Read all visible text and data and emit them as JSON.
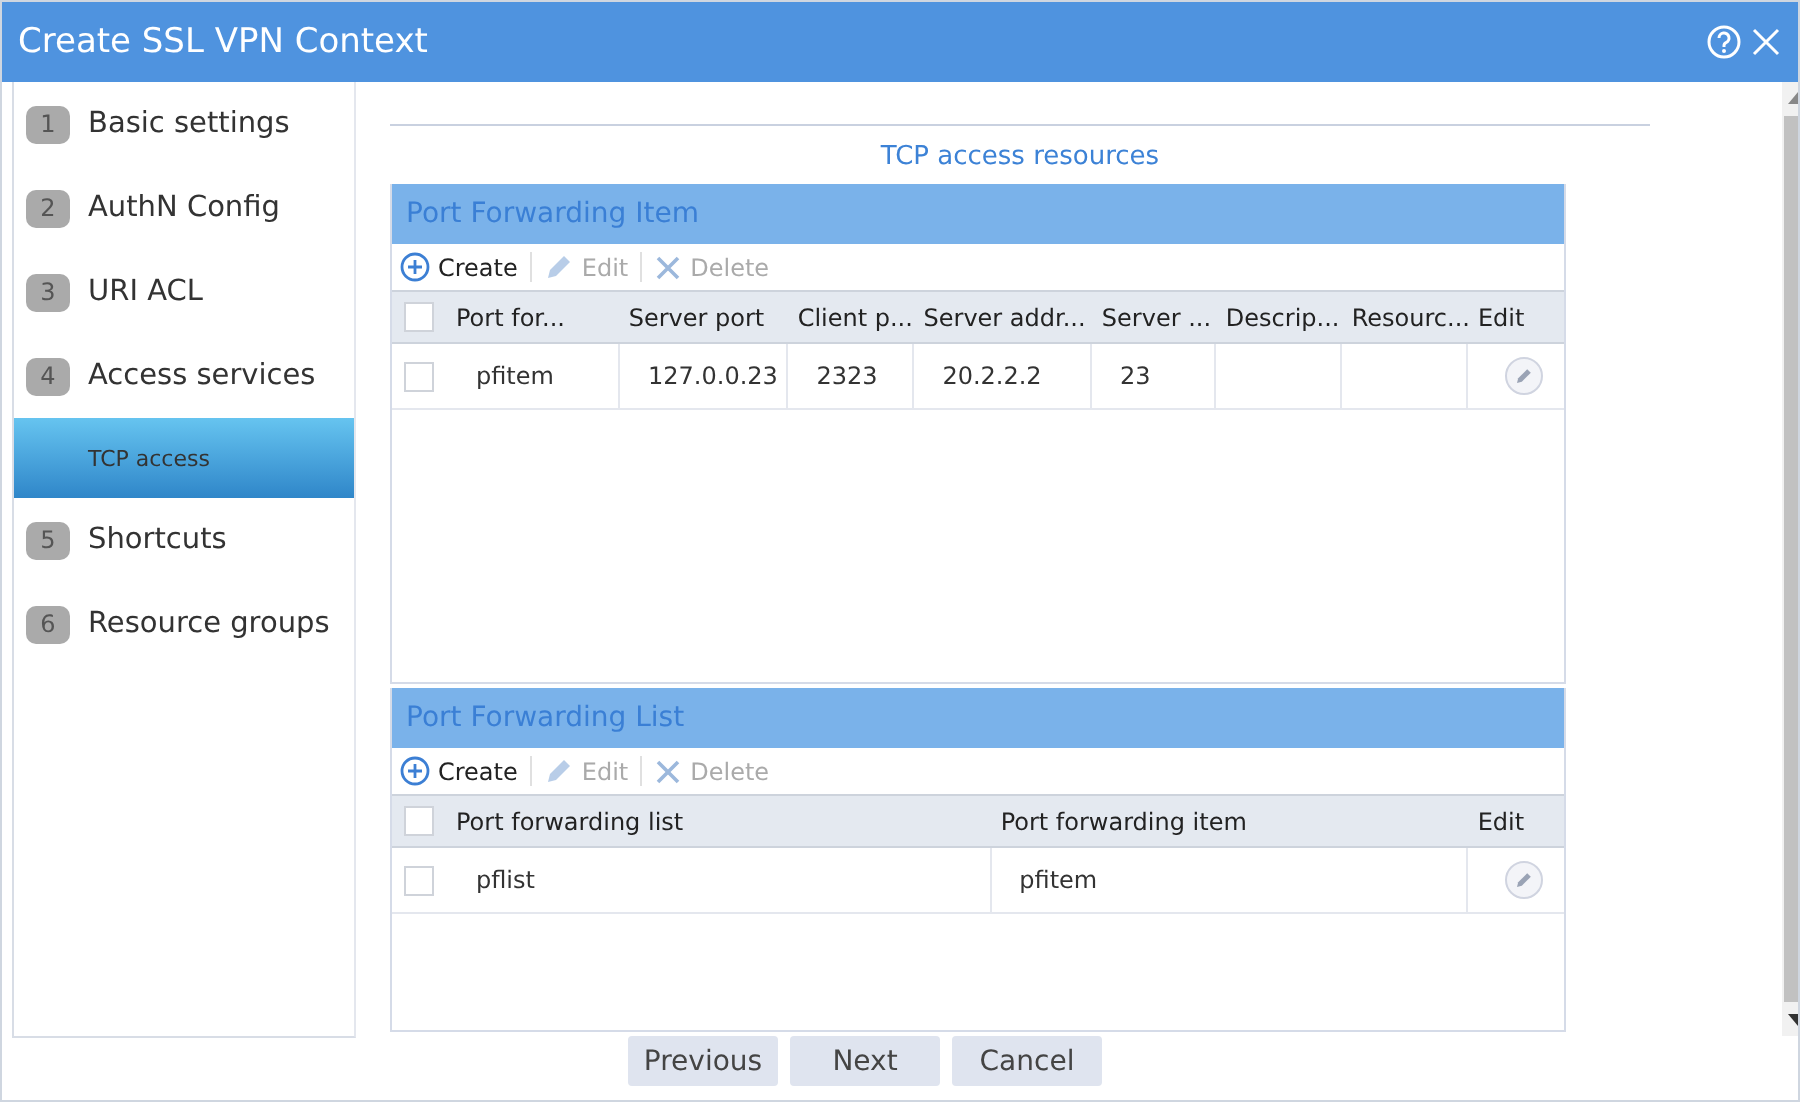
{
  "window": {
    "title": "Create SSL VPN Context"
  },
  "steps": [
    {
      "number": "1",
      "label": "Basic settings",
      "selected": false
    },
    {
      "number": "2",
      "label": "AuthN Config",
      "selected": false
    },
    {
      "number": "3",
      "label": "URI ACL",
      "selected": false
    },
    {
      "number": "4",
      "label": "Access services",
      "selected": false,
      "children": [
        {
          "label": "TCP access",
          "selected": true
        }
      ]
    },
    {
      "number": "5",
      "label": "Shortcuts",
      "selected": false
    },
    {
      "number": "6",
      "label": "Resource groups",
      "selected": false
    }
  ],
  "section_title": "TCP access resources",
  "panels": [
    {
      "title": "Port Forwarding Item",
      "toolbar": [
        {
          "kind": "create",
          "label": "Create",
          "disabled": false
        },
        {
          "kind": "edit",
          "label": "Edit",
          "disabled": true
        },
        {
          "kind": "delete",
          "label": "Delete",
          "disabled": true
        }
      ],
      "select_all_checked": false,
      "columns": [
        "Port for...",
        "Server port",
        "Client p...",
        "Server addr...",
        "Server ...",
        "Descrip...",
        "Resourc...",
        "Edit"
      ],
      "rows": [
        {
          "checked": false,
          "cells": [
            "pfitem",
            "127.0.0.23",
            "2323",
            "20.2.2.2",
            "23",
            "",
            ""
          ]
        }
      ]
    },
    {
      "title": "Port Forwarding List",
      "toolbar": [
        {
          "kind": "create",
          "label": "Create",
          "disabled": false
        },
        {
          "kind": "edit",
          "label": "Edit",
          "disabled": true
        },
        {
          "kind": "delete",
          "label": "Delete",
          "disabled": true
        }
      ],
      "select_all_checked": false,
      "columns": [
        "Port forwarding list",
        "Port forwarding item",
        "Edit"
      ],
      "rows": [
        {
          "checked": false,
          "cells": [
            "pflist",
            "pfitem"
          ]
        }
      ]
    }
  ],
  "buttons": [
    "Previous",
    "Next",
    "Cancel"
  ]
}
